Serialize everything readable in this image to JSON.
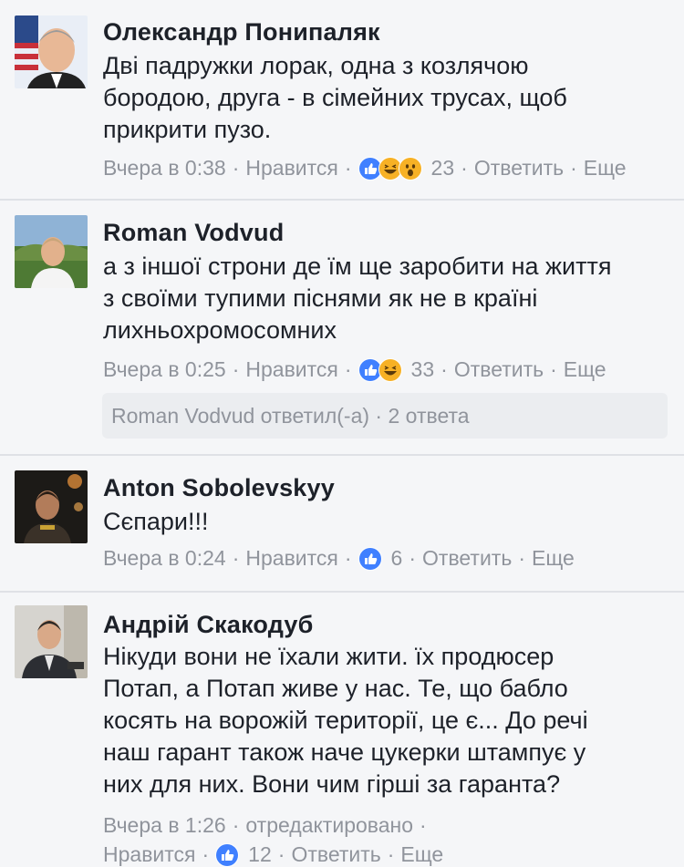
{
  "comments": [
    {
      "author": "Олександр Понипаляк",
      "lines": [
        "Дві падружки лорак, одна з козлячою",
        "бородою, друга - в сімейних трусах, щоб",
        "прикрити пузо."
      ],
      "time": "Вчера в 0:38",
      "like": "Нравится",
      "reactions": [
        "like-icon",
        "haha-icon",
        "wow-icon"
      ],
      "count": "23",
      "reply": "Ответить",
      "more": "Еще"
    },
    {
      "author": "Roman Vodvud",
      "lines": [
        "а з іншої строни де їм ще заробити на життя",
        "з своїми тупими піснями як не в країні",
        "лихньохромосомних"
      ],
      "time": "Вчера в 0:25",
      "like": "Нравится",
      "reactions": [
        "like-icon",
        "haha-icon"
      ],
      "count": "33",
      "reply": "Ответить",
      "more": "Еще",
      "replies_summary": "Roman Vodvud ответил(-а) · 2 ответа"
    },
    {
      "author": "Anton Sobolevskyy",
      "lines": [
        "Сєпари!!!"
      ],
      "time": "Вчера в 0:24",
      "like": "Нравится",
      "reactions": [
        "like-icon"
      ],
      "count": "6",
      "reply": "Ответить",
      "more": "Еще"
    },
    {
      "author": "Андрій Скакодуб",
      "lines": [
        "Нікуди вони не їхали жити. їх продюсер",
        "Потап, а Потап живе у нас. Те, що бабло",
        "косять на ворожій території, це є... До речі",
        "наш гарант також наче цукерки штампує у",
        "них для них. Вони чим гірші за гаранта?"
      ],
      "time": "Вчера в 1:26",
      "edited": "отредактировано",
      "like": "Нравится",
      "reactions": [
        "like-icon"
      ],
      "count": "12",
      "reply": "Ответить",
      "more": "Еще"
    }
  ],
  "colors": {
    "like_blue": "#4080ff",
    "haha_yellow": "#f7b125",
    "meta_gray": "#90949c",
    "divider": "#dfe1e6"
  }
}
